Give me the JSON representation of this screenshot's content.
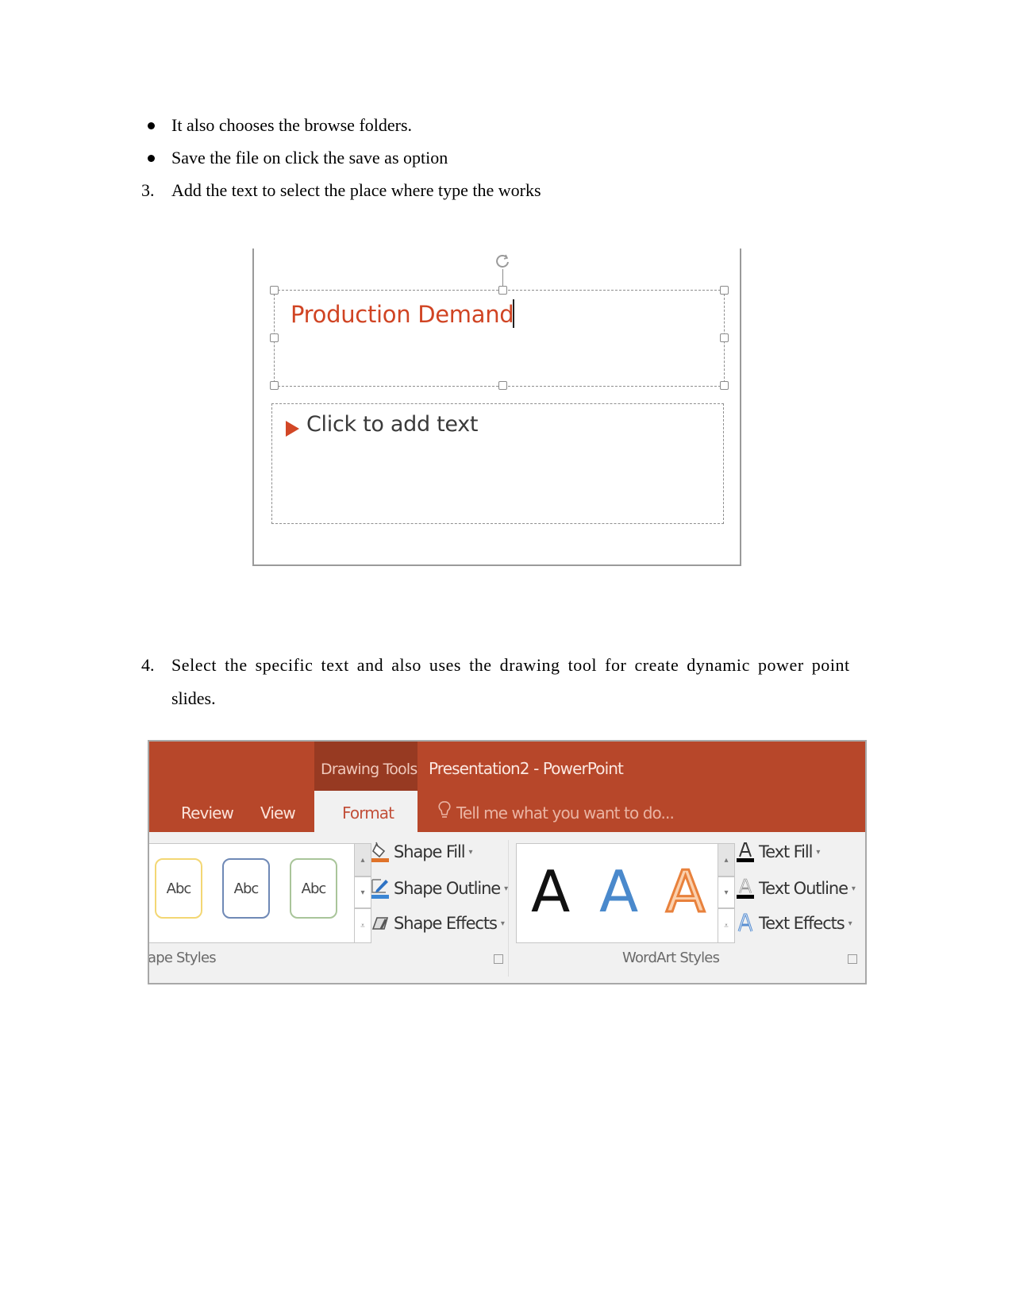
{
  "document": {
    "items": [
      {
        "marker": "bullet",
        "text": "It also chooses the browse folders."
      },
      {
        "marker": "bullet",
        "text": "Save the file on click the save as option"
      },
      {
        "marker": "3.",
        "text": "Add the text to select the place where type the works"
      },
      {
        "marker": "4.",
        "text_line1": "Select the specific text and also uses the drawing tool for create dynamic power point",
        "text_line2": "slides."
      }
    ]
  },
  "slide_figure": {
    "title_placeholder_text": "Production Demand",
    "body_placeholder_text": "Click to add text",
    "accent_color": "#d04423"
  },
  "ribbon_figure": {
    "context_group_label": "Drawing Tools",
    "app_title": "Presentation2 - PowerPoint",
    "tabs": [
      {
        "label": "Review",
        "active": false
      },
      {
        "label": "View",
        "active": false
      },
      {
        "label": "Format",
        "active": true
      }
    ],
    "tell_me_placeholder": "Tell me what you want to do...",
    "shape_style_thumbnails": [
      "Abc",
      "Abc",
      "Abc"
    ],
    "shape_commands": [
      {
        "label": "Shape Fill",
        "icon": "paint-bucket-icon"
      },
      {
        "label": "Shape Outline",
        "icon": "pencil-outline-icon"
      },
      {
        "label": "Shape Effects",
        "icon": "shape-effects-icon"
      }
    ],
    "shape_styles_group_label": "ape Styles",
    "wordart_samples": [
      {
        "glyph": "A",
        "style": "black-fill"
      },
      {
        "glyph": "A",
        "style": "blue-fill"
      },
      {
        "glyph": "A",
        "style": "orange-outline"
      }
    ],
    "text_commands": [
      {
        "label": "Text Fill",
        "icon": "text-fill-icon"
      },
      {
        "label": "Text Outline",
        "icon": "text-outline-icon"
      },
      {
        "label": "Text Effects",
        "icon": "text-effects-icon"
      }
    ],
    "wordart_group_label": "WordArt Styles",
    "brand_color": "#b7472a"
  }
}
